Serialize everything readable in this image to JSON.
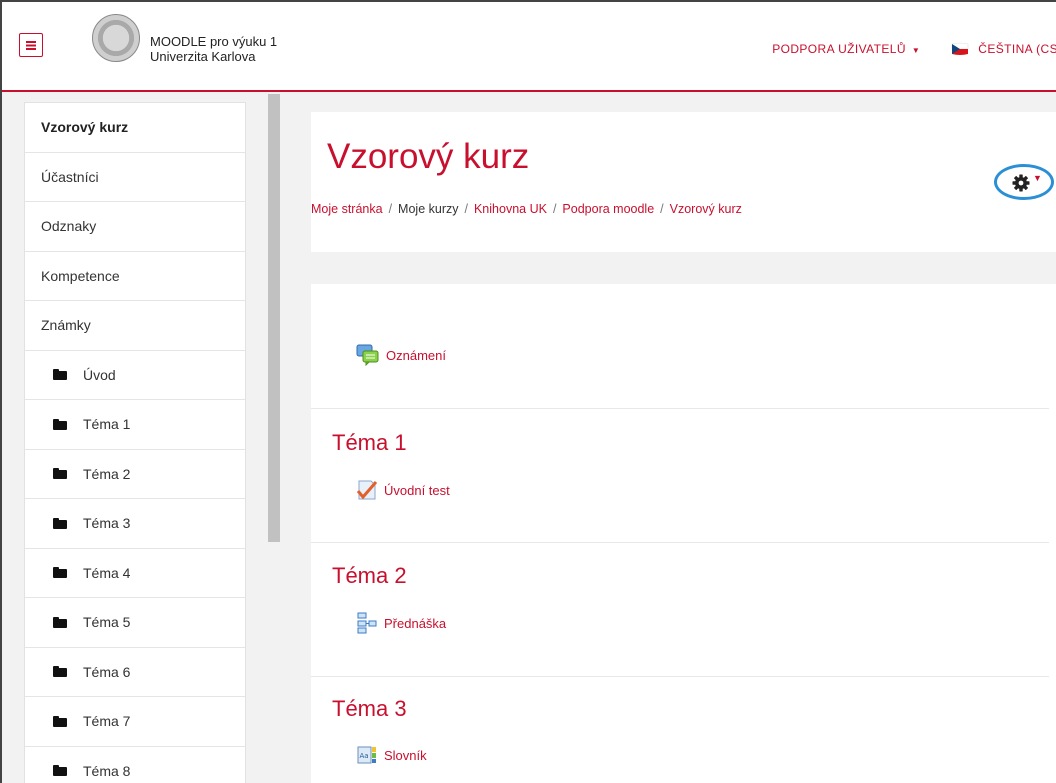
{
  "header": {
    "site_name": "MOODLE pro výuku 1",
    "university": "Univerzita Karlova",
    "support_label": "PODPORA UŽIVATELŮ",
    "language_label": "ČEŠTINA (CS"
  },
  "sidebar": {
    "items": [
      {
        "label": "Vzorový kurz"
      },
      {
        "label": "Účastníci"
      },
      {
        "label": "Odznaky"
      },
      {
        "label": "Kompetence"
      },
      {
        "label": "Známky"
      },
      {
        "label": "Úvod"
      },
      {
        "label": "Téma 1"
      },
      {
        "label": "Téma 2"
      },
      {
        "label": "Téma 3"
      },
      {
        "label": "Téma 4"
      },
      {
        "label": "Téma 5"
      },
      {
        "label": "Téma 6"
      },
      {
        "label": "Téma 7"
      },
      {
        "label": "Téma 8"
      }
    ]
  },
  "main": {
    "page_title": "Vzorový kurz",
    "breadcrumb": [
      "Moje stránka",
      "Moje kurzy",
      "Knihovna UK",
      "Podpora moodle",
      "Vzorový kurz"
    ],
    "announcement": "Oznámení",
    "sections": [
      {
        "title": "Téma 1",
        "activity": "Úvodní test"
      },
      {
        "title": "Téma 2",
        "activity": "Přednáška"
      },
      {
        "title": "Téma 3",
        "activity": "Slovník"
      }
    ]
  },
  "colors": {
    "accent": "#c8102e",
    "highlight_ring": "#2b8fd6"
  }
}
